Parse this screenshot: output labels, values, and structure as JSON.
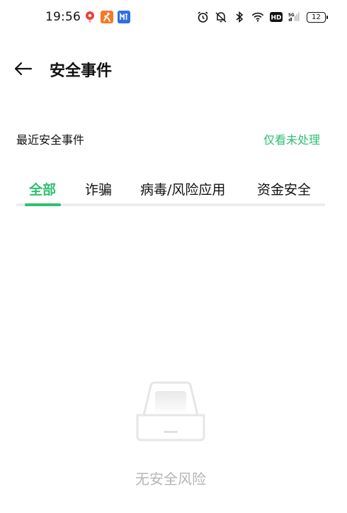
{
  "status_bar": {
    "time": "19:56",
    "battery": "12",
    "network_label": "5G",
    "hd_label": "HD"
  },
  "header": {
    "title": "安全事件"
  },
  "section": {
    "label": "最近安全事件",
    "filter_link": "仅看未处理"
  },
  "tabs": [
    {
      "label": "全部",
      "active": true
    },
    {
      "label": "诈骗",
      "active": false
    },
    {
      "label": "病毒/风险应用",
      "active": false
    },
    {
      "label": "资金安全",
      "active": false
    }
  ],
  "empty_state": {
    "text": "无安全风险"
  },
  "colors": {
    "accent": "#2fbf71",
    "muted_text": "#b5b5b5",
    "track": "#ededed"
  }
}
